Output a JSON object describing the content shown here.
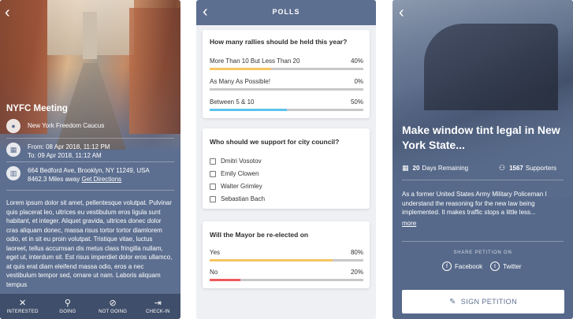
{
  "screen1": {
    "event_title": "NYFC Meeting",
    "organizer": "New York Freedom Caucus",
    "date_from": "From: 08 Apr 2018, 11:12 PM",
    "date_to": "To: 09 Apr 2018, 11:12 AM",
    "address": "664 Bedford Ave, Brooklyn, NY 11249, USA",
    "distance": "8462.3 Miles away",
    "directions_link": "Get Directions",
    "description": "Lorem ipsum dolor sit amet, pellentesque volutpat. Pulvinar quis placerat leo, ultrices eu vestibulum eros ligula sunt habitant, et integer. Aliquet gravida, ultrices donec dolor cras aliquam donec, massa risus tortor tortor diamlorem odio, et in sit eu proin volutpat. Tristique vitae, luctus laoreet, tellus accumsan dis metus class fringilla nullam, eget ut, interdum sit. Est risus imperdiet dolor eros ullamco, at quis erat diam eleifend massa odio, eros a nec vestibulum tempor sed, ornare ut nam. Laboris aliquam tempus",
    "actions": [
      {
        "label": "INTERESTED",
        "icon": "✕"
      },
      {
        "label": "GOING",
        "icon": "⚲"
      },
      {
        "label": "NOT GOING",
        "icon": "⊘"
      },
      {
        "label": "CHECK-IN",
        "icon": "⇥"
      }
    ]
  },
  "screen2": {
    "nav_title": "POLLS",
    "polls": [
      {
        "question": "How many rallies should be held this year?",
        "options": [
          {
            "label": "More Than 10 But Less Than 20",
            "percent": "40%",
            "value": 40,
            "color": "#f5c462"
          },
          {
            "label": "As Many As Possible!",
            "percent": "0%",
            "value": 0,
            "color": "#f5c462"
          },
          {
            "label": "Between 5 & 10",
            "percent": "50%",
            "value": 50,
            "color": "#5bc3ee"
          }
        ]
      },
      {
        "question": "Who should we support for city council?",
        "choices": [
          "Dmitri Vosotov",
          "Emily Clowen",
          "Walter Grimley",
          "Sebastian Bach"
        ]
      },
      {
        "question": "Will the Mayor be re-elected on",
        "options": [
          {
            "label": "Yes",
            "percent": "80%",
            "value": 80,
            "color": "#f5c462"
          },
          {
            "label": "No",
            "percent": "20%",
            "value": 20,
            "color": "#ee5b5b"
          }
        ]
      }
    ]
  },
  "screen3": {
    "title": "Make window tint legal in New York State...",
    "days_count": "20",
    "days_label": "Days Remaining",
    "supporters_count": "1567",
    "supporters_label": "Supporters",
    "description": "As a former United States Army Military Policeman I understand the reasoning for the new law being implemented. It makes traffic stops a little less...",
    "more_link": "more",
    "share_label": "SHARE PETITION ON",
    "facebook_label": "Facebook",
    "twitter_label": "Twitter",
    "sign_button": "SIGN PETITION"
  }
}
